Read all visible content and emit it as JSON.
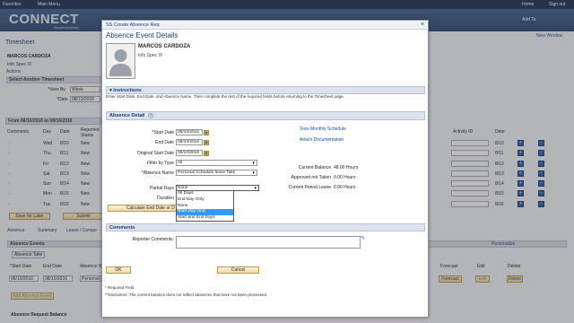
{
  "topbar": {
    "favorites": "Favorites",
    "main_menu": "Main Menu",
    "home": "Home",
    "sign_out": "Sign out"
  },
  "header": {
    "logo": "CONNECT",
    "logo_sub": "Maryland judiciary",
    "add_to": "Add To",
    "new_window": "New Window"
  },
  "background": {
    "page_title": "Timesheet",
    "employee_name": "MARCOS CARDOZA",
    "employee_job": "Info Spec IX",
    "actions": "Actions",
    "select_timesheet": "Select Another Timesheet",
    "view_by_label": "*View By",
    "view_by_value": "Week",
    "date_label": "*Date",
    "date_value": "08/10/2016",
    "period": "From 08/10/2016 to 08/16/2016",
    "columns": [
      "Comments",
      "Day",
      "Date",
      "Reported Status",
      "Activity ID",
      "Date"
    ],
    "rows": [
      {
        "day": "Wed",
        "date": "8/10",
        "status": "New",
        "right_date": "8/10"
      },
      {
        "day": "Thu",
        "date": "8/11",
        "status": "New",
        "right_date": "8/11"
      },
      {
        "day": "Fri",
        "date": "8/12",
        "status": "New",
        "right_date": "8/12"
      },
      {
        "day": "Sat",
        "date": "8/13",
        "status": "New",
        "right_date": "8/13"
      },
      {
        "day": "Sun",
        "date": "8/14",
        "status": "New",
        "right_date": "8/14"
      },
      {
        "day": "Mon",
        "date": "8/15",
        "status": "New",
        "right_date": "8/15"
      },
      {
        "day": "Tue",
        "date": "8/16",
        "status": "New",
        "right_date": "8/16"
      }
    ],
    "save_for_later": "Save for Later",
    "submit": "Submit",
    "tabs": [
      "Absence",
      "Summary",
      "Leave / Compe"
    ],
    "absence_events": "Absence Events",
    "absence_take_tab": "Absence Take",
    "personalize": "Personalize",
    "abs_cols": [
      "*Start Date",
      "End Date",
      "Absence N",
      "Forecast",
      "Edit",
      "Delete"
    ],
    "abs_start": "08/10/2016",
    "abs_end": "08/10/2016",
    "abs_name": "Personal",
    "forecast_btn": "Forecast",
    "edit_btn": "Edit",
    "delete_btn": "Delete",
    "add_absence": "Add Absence Event",
    "absence_request_balance": "Absence Request Balance"
  },
  "modal": {
    "title": "SS Create Absence Req",
    "heading": "Absence Event Details",
    "employee_name": "MARCOS CARDOZA",
    "employee_job": "Info Spec IX",
    "instructions_title": "Instructions",
    "instructions_text": "Enter Start Date, End Date, and Absence Name. Then complete the rest of the required fields before returning to the Timesheet page.",
    "absence_detail_title": "Absence Detail",
    "start_date_label": "*Start Date",
    "start_date": "08/10/2016",
    "end_date_label": "End Date",
    "end_date": "08/10/2016",
    "orig_start_label": "Original Start Date",
    "orig_start": "08/10/2016",
    "filter_label": "Filter by Type",
    "filter_value": "All",
    "absence_name_label": "*Absence Name",
    "absence_name_value": "Personal Schedule leave Take",
    "partial_days_label": "Partial Days",
    "partial_days_value": "None",
    "duration_label": "Duration",
    "partial_options": [
      "All Days",
      "End Day Only",
      "None",
      "Start Day Only",
      "Start and End Days"
    ],
    "partial_highlight": "Start Day Only",
    "calc_button": "Calculate End Date or D",
    "view_schedule": "View Monthly Schedule",
    "attach_docs": "Attach Documentation",
    "current_balance_label": "Current Balance",
    "current_balance": "48.00 Hours",
    "approved_label": "Approved not Taken",
    "approved": "0.00 Hours",
    "current_period_label": "Current Period Leave",
    "current_period": "0.00 Hours",
    "comments_title": "Comments",
    "reporter_comments_label": "Reporter Comments:",
    "ok_button": "OK",
    "cancel_button": "Cancel",
    "required_note": "* Required Field",
    "disclaimer": "**Disclaimer: The current balance does not reflect absences that have not been processed."
  }
}
